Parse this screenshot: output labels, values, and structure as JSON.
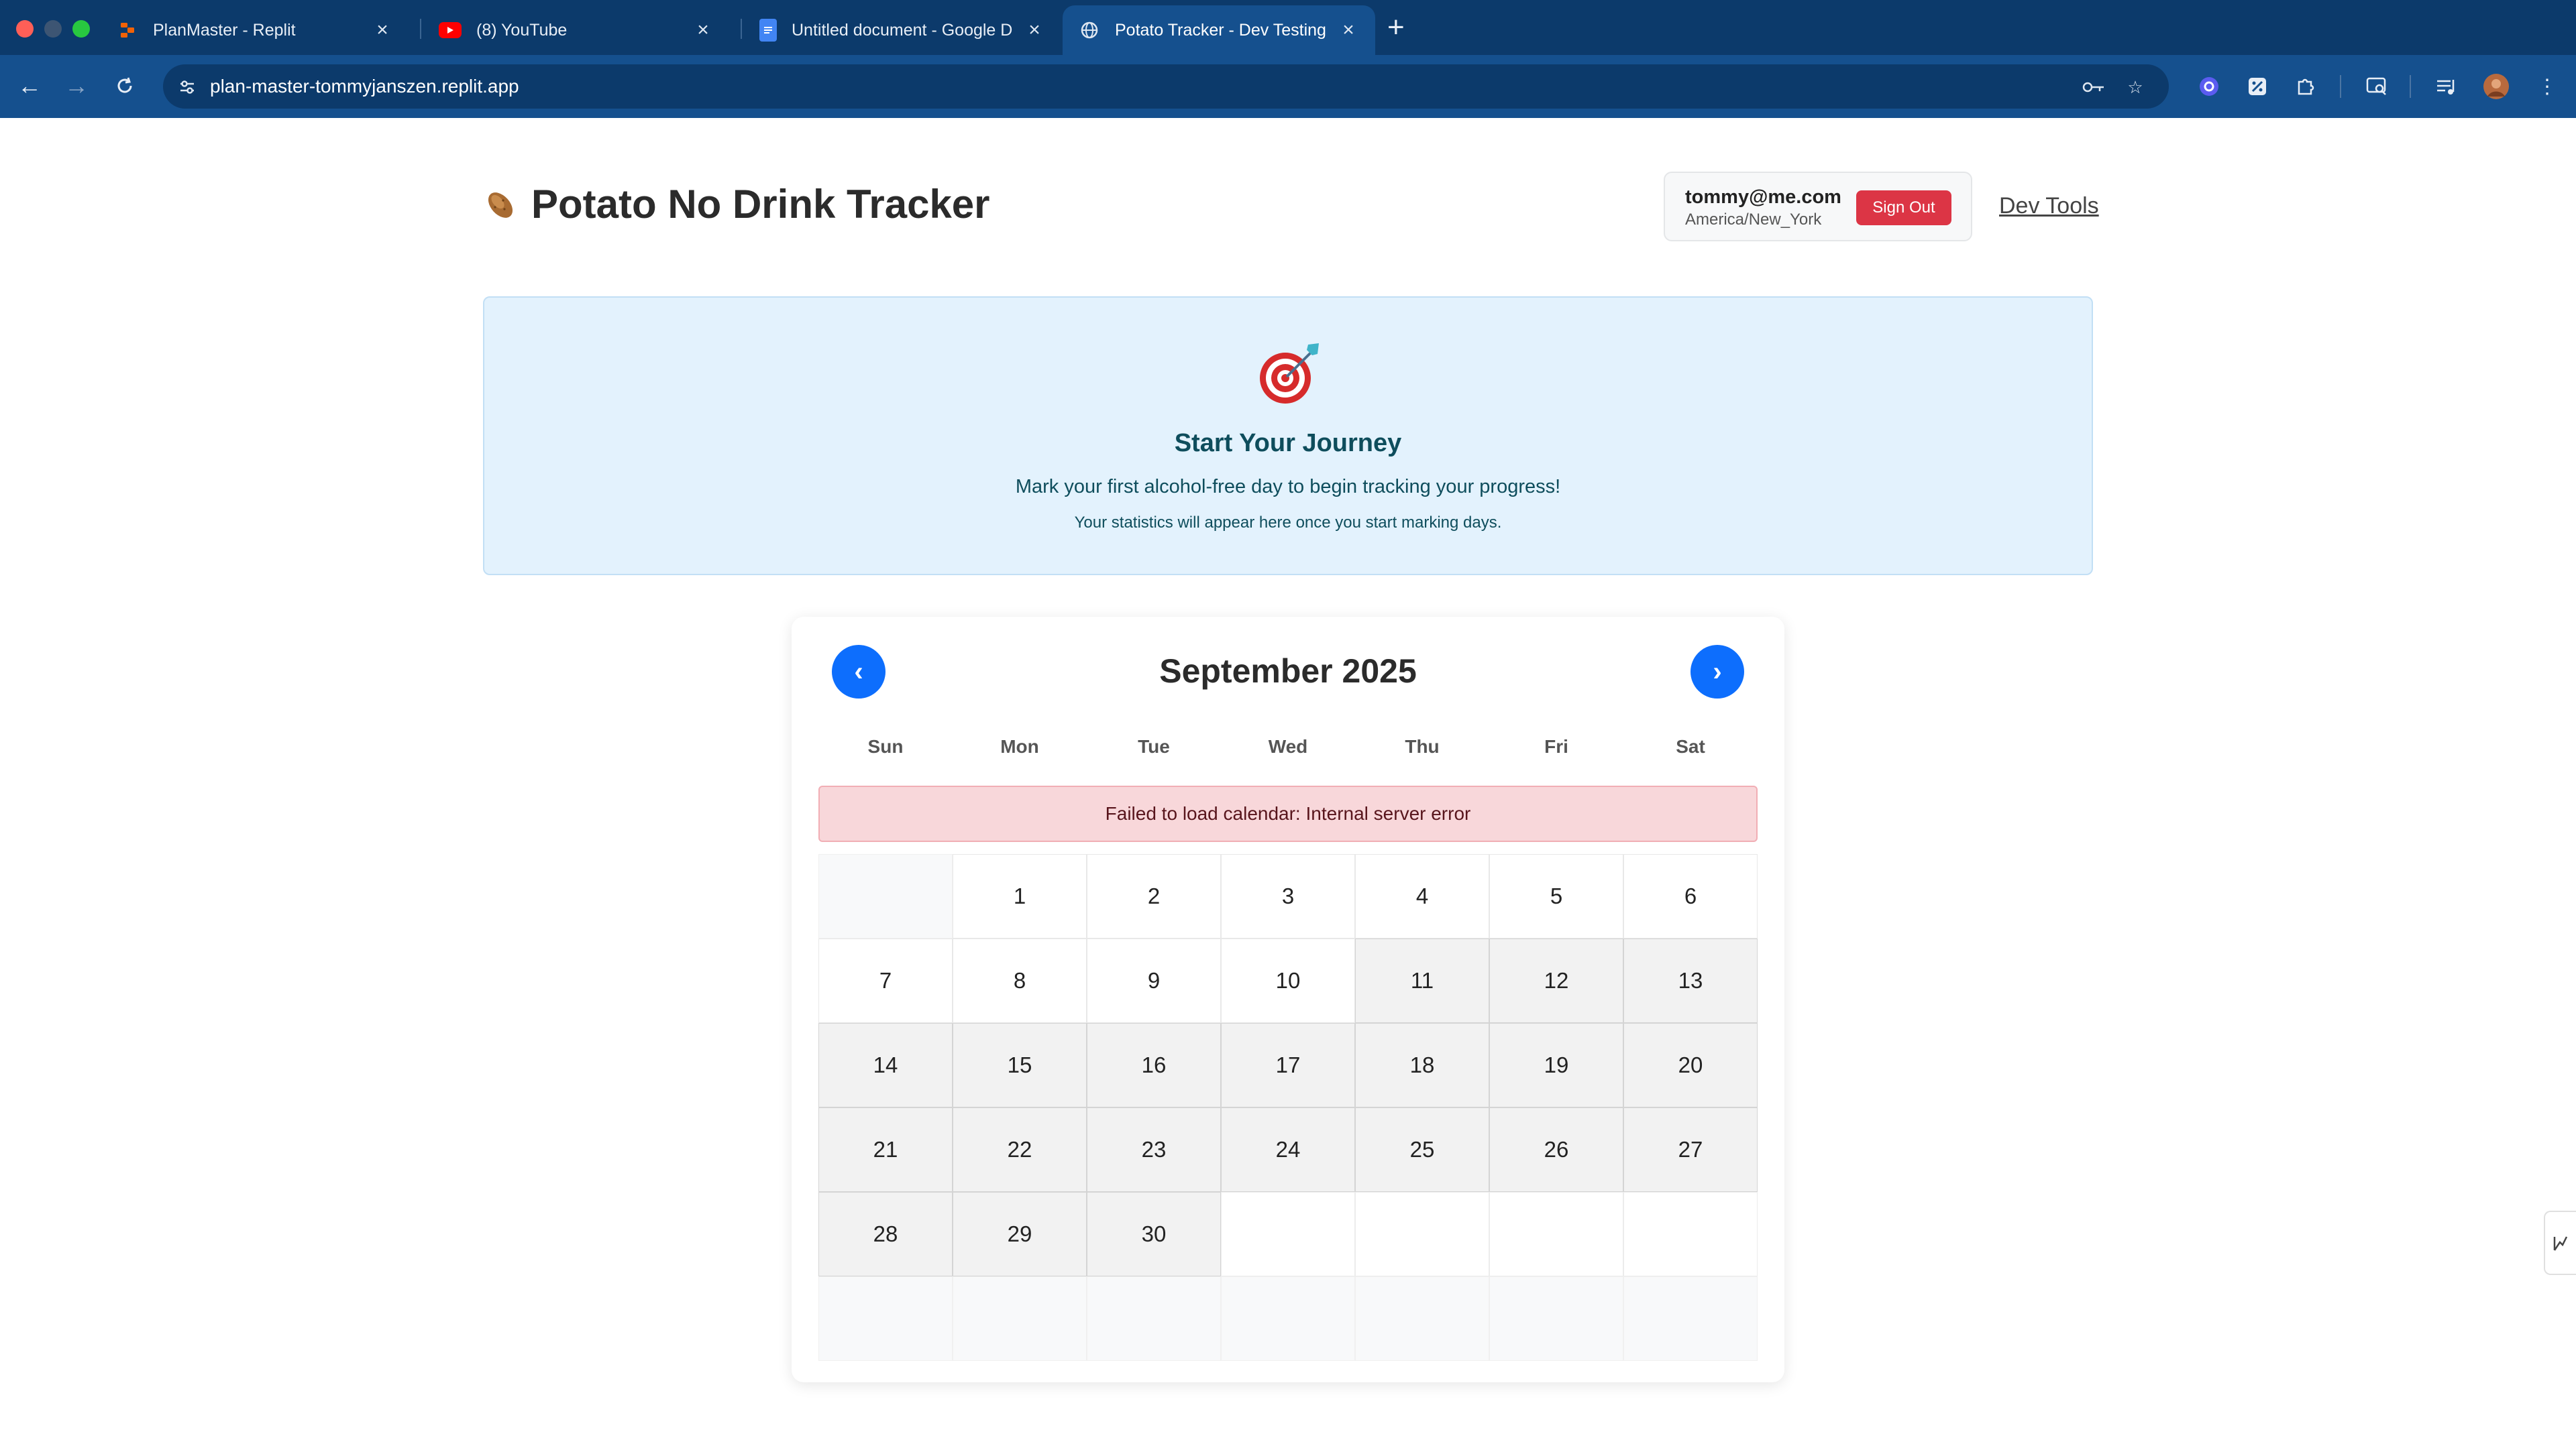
{
  "browser": {
    "tabs": [
      {
        "title": "PlanMaster - Replit",
        "icon": "replit-icon"
      },
      {
        "title": "(8) YouTube",
        "icon": "youtube-icon"
      },
      {
        "title": "Untitled document - Google D",
        "icon": "google-docs-icon"
      },
      {
        "title": "Potato Tracker - Dev Testing",
        "icon": "globe-icon",
        "active": true
      }
    ],
    "url": "plan-master-tommyjanszen.replit.app"
  },
  "header": {
    "title": "Potato No Drink Tracker",
    "icon": "potato-icon",
    "user_email": "tommy@me.com",
    "user_timezone": "America/New_York",
    "sign_out_label": "Sign Out",
    "dev_tools_label": "Dev Tools"
  },
  "journey": {
    "icon": "target-icon",
    "title": "Start Your Journey",
    "message": "Mark your first alcohol-free day to begin tracking your progress!",
    "note": "Your statistics will appear here once you start marking days."
  },
  "calendar": {
    "prev_label": "‹",
    "next_label": "›",
    "month_label": "September 2025",
    "weekdays": [
      "Sun",
      "Mon",
      "Tue",
      "Wed",
      "Thu",
      "Fri",
      "Sat"
    ],
    "error": "Failed to load calendar: Internal server error",
    "days": [
      "",
      "1",
      "2",
      "3",
      "4",
      "5",
      "6",
      "7",
      "8",
      "9",
      "10",
      "11",
      "12",
      "13",
      "14",
      "15",
      "16",
      "17",
      "18",
      "19",
      "20",
      "21",
      "22",
      "23",
      "24",
      "25",
      "26",
      "27",
      "28",
      "29",
      "30",
      "",
      "",
      "",
      "",
      "",
      "",
      "",
      "",
      "",
      "",
      "",
      ""
    ]
  },
  "colors": {
    "chrome_tabbar": "#0c3a6b",
    "chrome_toolbar": "#15508e",
    "accent_blue": "#0d6efd",
    "danger_red": "#dc3545",
    "journey_bg": "#e3f2fd",
    "error_bg": "#f8d7da"
  }
}
